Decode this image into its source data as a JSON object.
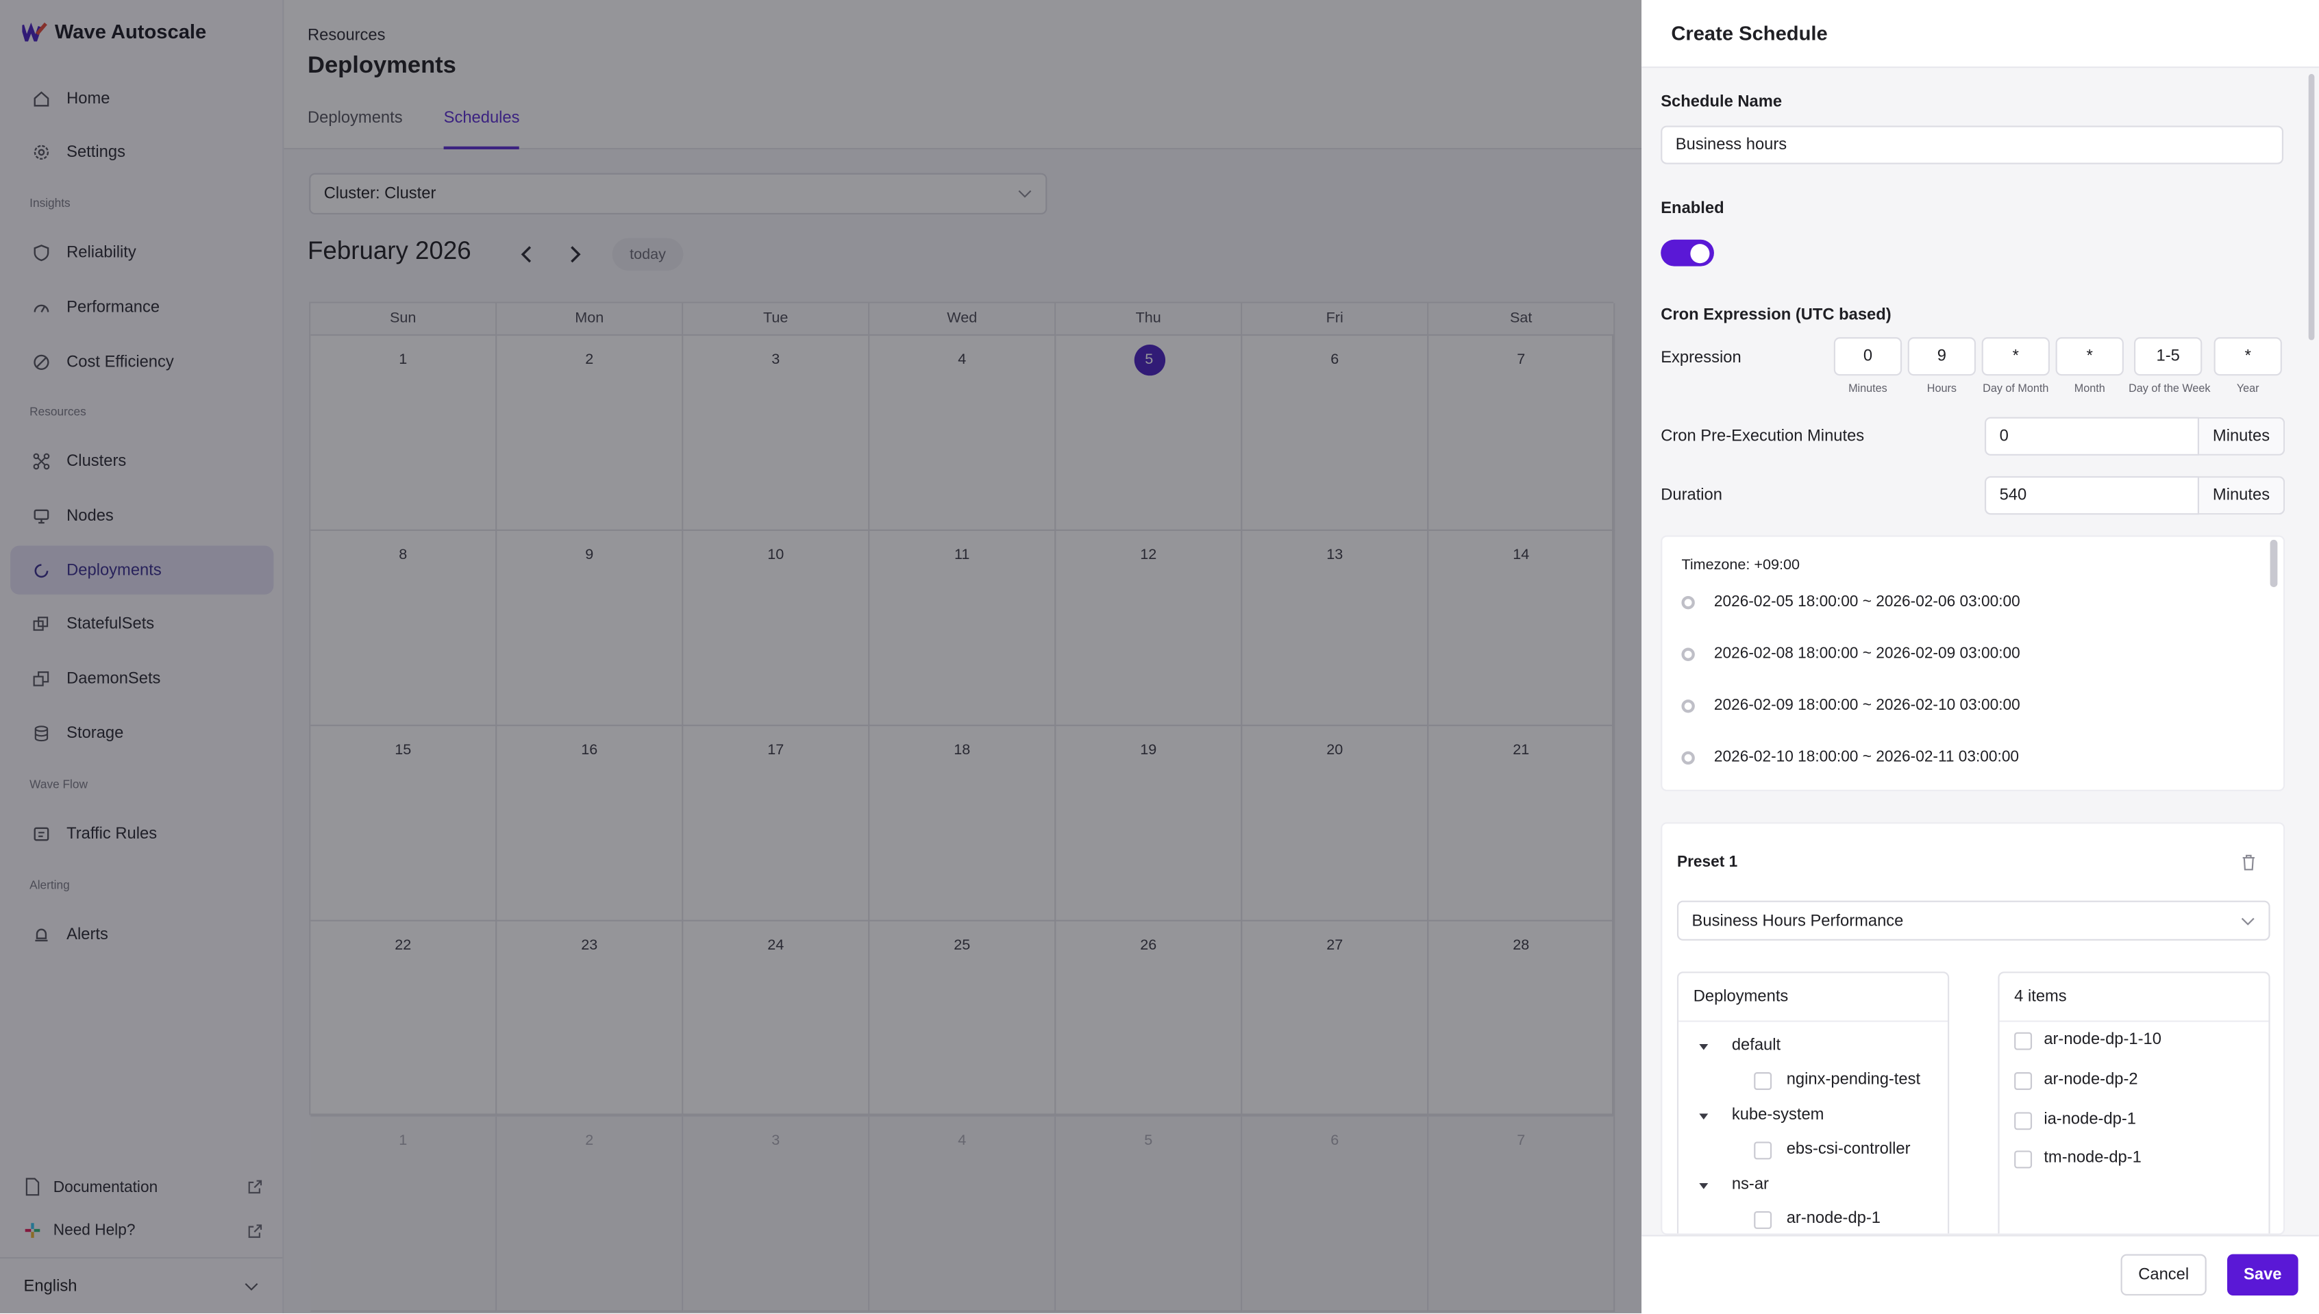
{
  "app": {
    "name": "Wave Autoscale"
  },
  "sidebar": {
    "items": [
      {
        "label": "Home",
        "icon": "home-icon"
      },
      {
        "label": "Settings",
        "icon": "gear-icon"
      },
      {
        "label": "Reliability",
        "icon": "shield-icon"
      },
      {
        "label": "Performance",
        "icon": "gauge-icon"
      },
      {
        "label": "Cost Efficiency",
        "icon": "cost-icon"
      },
      {
        "label": "Clusters",
        "icon": "cluster-icon"
      },
      {
        "label": "Nodes",
        "icon": "node-icon"
      },
      {
        "label": "Deployments",
        "icon": "deployment-icon",
        "active": true
      },
      {
        "label": "StatefulSets",
        "icon": "statefulset-icon"
      },
      {
        "label": "DaemonSets",
        "icon": "daemonset-icon"
      },
      {
        "label": "Storage",
        "icon": "database-icon"
      },
      {
        "label": "Traffic Rules",
        "icon": "traffic-icon"
      },
      {
        "label": "Alerts",
        "icon": "bell-icon"
      }
    ],
    "sections": [
      "Insights",
      "Resources",
      "Wave Flow",
      "Alerting"
    ],
    "footer": {
      "documentation": "Documentation",
      "help": "Need Help?",
      "language": "English"
    }
  },
  "header": {
    "breadcrumb": "Resources",
    "title": "Deployments",
    "tabs": [
      "Deployments",
      "Schedules"
    ],
    "active_tab": "Schedules"
  },
  "filter": {
    "cluster": "Cluster: Cluster"
  },
  "calendar": {
    "month": "February 2026",
    "today_label": "today",
    "weekdays": [
      "Sun",
      "Mon",
      "Tue",
      "Wed",
      "Thu",
      "Fri",
      "Sat"
    ],
    "weeks": [
      [
        "1",
        "2",
        "3",
        "4",
        "5",
        "6",
        "7"
      ],
      [
        "8",
        "9",
        "10",
        "11",
        "12",
        "13",
        "14"
      ],
      [
        "15",
        "16",
        "17",
        "18",
        "19",
        "20",
        "21"
      ],
      [
        "22",
        "23",
        "24",
        "25",
        "26",
        "27",
        "28"
      ],
      [
        "1",
        "2",
        "3",
        "4",
        "5",
        "6",
        "7"
      ]
    ],
    "today": "5"
  },
  "drawer": {
    "title": "Create Schedule",
    "schedule_name_label": "Schedule Name",
    "schedule_name": "Business hours",
    "enabled_label": "Enabled",
    "enabled": true,
    "cron_label": "Cron Expression (UTC based)",
    "expression_label": "Expression",
    "cron_fields": [
      {
        "value": "0",
        "label": "Minutes"
      },
      {
        "value": "9",
        "label": "Hours"
      },
      {
        "value": "*",
        "label": "Day of Month"
      },
      {
        "value": "*",
        "label": "Month"
      },
      {
        "value": "1-5",
        "label": "Day of the Week"
      },
      {
        "value": "*",
        "label": "Year"
      }
    ],
    "pre_exec_label": "Cron Pre-Execution Minutes",
    "pre_exec_value": "0",
    "duration_label": "Duration",
    "duration_value": "540",
    "unit": "Minutes",
    "timezone": "Timezone: +09:00",
    "windows": [
      "2026-02-05 18:00:00 ~ 2026-02-06 03:00:00",
      "2026-02-08 18:00:00 ~ 2026-02-09 03:00:00",
      "2026-02-09 18:00:00 ~ 2026-02-10 03:00:00",
      "2026-02-10 18:00:00 ~ 2026-02-11 03:00:00"
    ],
    "preset": {
      "title": "Preset 1",
      "selected": "Business Hours Performance",
      "tree_header": "Deployments",
      "tree": [
        {
          "ns": "default",
          "items": [
            "nginx-pending-test"
          ]
        },
        {
          "ns": "kube-system",
          "items": [
            "ebs-csi-controller"
          ]
        },
        {
          "ns": "ns-ar",
          "items": [
            "ar-node-dp-1"
          ]
        }
      ],
      "list_header": "4 items",
      "list": [
        "ar-node-dp-1-10",
        "ar-node-dp-2",
        "ia-node-dp-1",
        "tm-node-dp-1"
      ]
    },
    "cancel": "Cancel",
    "save": "Save"
  },
  "colors": {
    "accent": "#5a18d6",
    "active_nav": "#e3e1f4"
  }
}
